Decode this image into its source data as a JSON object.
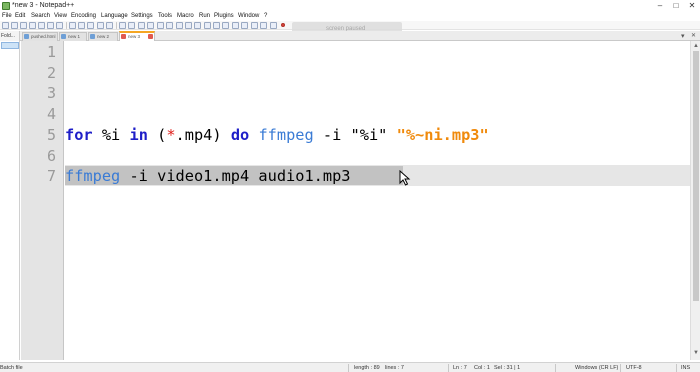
{
  "window": {
    "title": "*new 3 - Notepad++",
    "minimize": "–",
    "maximize": "□",
    "close": "✕"
  },
  "menu": {
    "items": [
      "File",
      "Edit",
      "Search",
      "View",
      "Encoding",
      "Language",
      "Settings",
      "Tools",
      "Macro",
      "Run",
      "Plugins",
      "Window",
      "?"
    ]
  },
  "tabs": {
    "left_panel_label": "Fold...",
    "items": [
      {
        "label": "pushed.html"
      },
      {
        "label": "new 1"
      },
      {
        "label": "new 2"
      },
      {
        "label": "new 3"
      }
    ],
    "dropdown": "▾",
    "close_x": "✕"
  },
  "overlay": {
    "text": "screen paused"
  },
  "editor": {
    "line_numbers": [
      "1",
      "2",
      "3",
      "4",
      "5",
      "6",
      "7"
    ],
    "line5": {
      "kw_for": "for",
      "var": " %i ",
      "kw_in": "in",
      "paren_open": " (",
      "star": "*",
      "pattern": ".mp4) ",
      "kw_do": "do",
      "cmd": " ffmpeg",
      "flag": " -i ",
      "arg1": "\"%i\"",
      "space": " ",
      "arg2": "\"%~ni.mp3\""
    },
    "line7": {
      "cmd": "ffmpeg",
      "rest": " -i video1.mp4 audio1.mp3"
    }
  },
  "status": {
    "file_type": "Batch file",
    "length": "length : 89",
    "lines": "lines : 7",
    "ln": "Ln : 7",
    "col": "Col : 1",
    "sel": "Sel : 31 | 1",
    "eol": "Windows (CR LF)",
    "encoding": "UTF-8",
    "mode": "INS"
  },
  "colors": {
    "keyword": "#1e1ec8",
    "command": "#3a7bd5",
    "string_orange": "#f08a0c",
    "operator": "#e0201c",
    "tab_accent": "#f5a623"
  }
}
